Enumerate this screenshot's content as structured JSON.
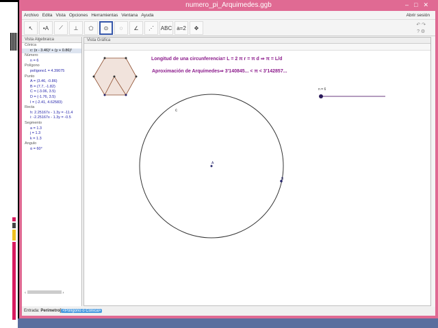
{
  "window": {
    "title": "numero_pi_Arquimedes.ggb"
  },
  "menu": [
    "Archivo",
    "Edita",
    "Vista",
    "Opciones",
    "Herramientas",
    "Ventana",
    "Ayuda"
  ],
  "login": "Abrir sesión",
  "toolbar": [
    {
      "icon": "move-icon",
      "glyph": "↖"
    },
    {
      "icon": "point-icon",
      "glyph": "•A"
    },
    {
      "icon": "line-icon",
      "glyph": "⟋"
    },
    {
      "icon": "perpendicular-icon",
      "glyph": "⊥"
    },
    {
      "icon": "polygon-icon",
      "glyph": "⬠"
    },
    {
      "icon": "circle-center-point-icon",
      "glyph": "⊙",
      "selected": true
    },
    {
      "icon": "circle-three-points-icon",
      "glyph": "◌"
    },
    {
      "icon": "angle-icon",
      "glyph": "∠"
    },
    {
      "icon": "reflect-icon",
      "glyph": "⋰"
    },
    {
      "icon": "text-icon",
      "glyph": "ABC"
    },
    {
      "icon": "slider-icon",
      "glyph": "a=2"
    },
    {
      "icon": "move-view-icon",
      "glyph": "✥"
    }
  ],
  "algebra": {
    "header": "Vista Algebraica",
    "groups": [
      {
        "label": "Cónica",
        "items": [
          "c: (x - 3.46)² + (y + 0.86)²"
        ]
      },
      {
        "label": "Número",
        "items": [
          "n = 6"
        ]
      },
      {
        "label": "Polígono",
        "items": [
          "polígono1 = 4.39075"
        ]
      },
      {
        "label": "Punto",
        "items": [
          "A = (3.46, -0.86)",
          "B = (7.7, -1.82)",
          "C = (-3.06, 3.5)",
          "D = (-1.76, 3.5)",
          "I = (-2.41, 4.62583)"
        ]
      },
      {
        "label": "Recta",
        "items": [
          "h: 2.25167x - 1.3y = -11.4",
          "i: -2.25167x - 1.3y = -0.5"
        ]
      },
      {
        "label": "Segmento",
        "items": [
          "a = 1.3",
          "j = 1.3",
          "k = 1.3"
        ]
      },
      {
        "label": "Ángulo",
        "items": [
          "α = 60°"
        ]
      }
    ]
  },
  "graphics": {
    "header": "Vista Gráfica",
    "text1": "Longitud de una circunferencia= L = 2 π r = π d ⇒ π = L/d",
    "text2": "Aproximación de Arquímedes⇒ 3'140845... < π < 3'142857...",
    "slider_label": "n = 6",
    "slider_value": 6,
    "circle_label": "c",
    "point_a": "A",
    "point_b": "B",
    "text_color": "#8b1a8b",
    "polygon_fill": "#f1e3dc"
  },
  "input": {
    "label": "Entrada:",
    "command": "Perímetro[",
    "hint": "<Polígono o Cónica>"
  }
}
